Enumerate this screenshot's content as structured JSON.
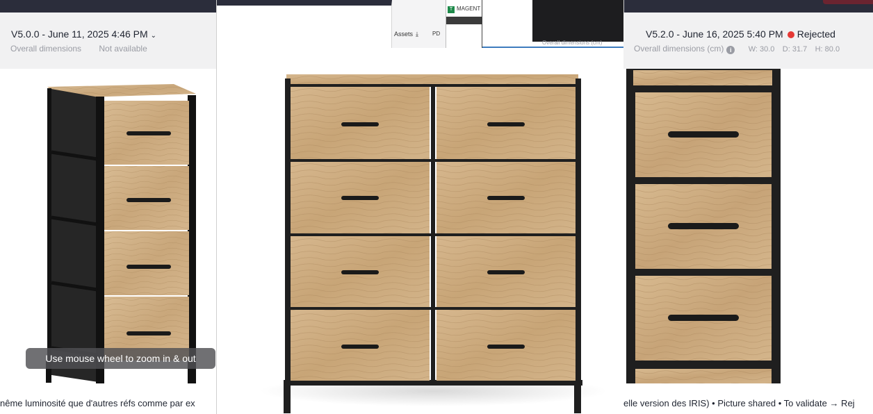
{
  "left_panel": {
    "version": "V5.0.0 - June 11, 2025 4:46 PM",
    "dims_label": "Overall dimensions",
    "dims_value": "Not available",
    "zoom_hint": "Use mouse wheel to zoom in & out",
    "comment": "nême luminosité que d'autres réfs comme par ex"
  },
  "right_panel": {
    "version": "V5.2.0 - June 16, 2025 5:40 PM",
    "status": "Rejected",
    "dims_label": "Overall dimensions (cm)",
    "width": "W: 30.0",
    "depth": "D: 31.7",
    "height": "H: 80.0",
    "comment": "elle version des IRIS) • Picture shared • To validate → Rej"
  },
  "viewer": {
    "assets_label": "Assets",
    "pdf_label": "PD",
    "magento_label": "MAGENT",
    "strip_dims": "Overall dimensions (cm)"
  },
  "colors": {
    "status_rejected": "#e53935",
    "accent_blue": "#3d7bbd",
    "topbar": "#2b2d3b"
  },
  "icons": [
    "chevron-down-icon",
    "info-icon",
    "download-icon",
    "magento-icon",
    "status-dot-icon"
  ]
}
